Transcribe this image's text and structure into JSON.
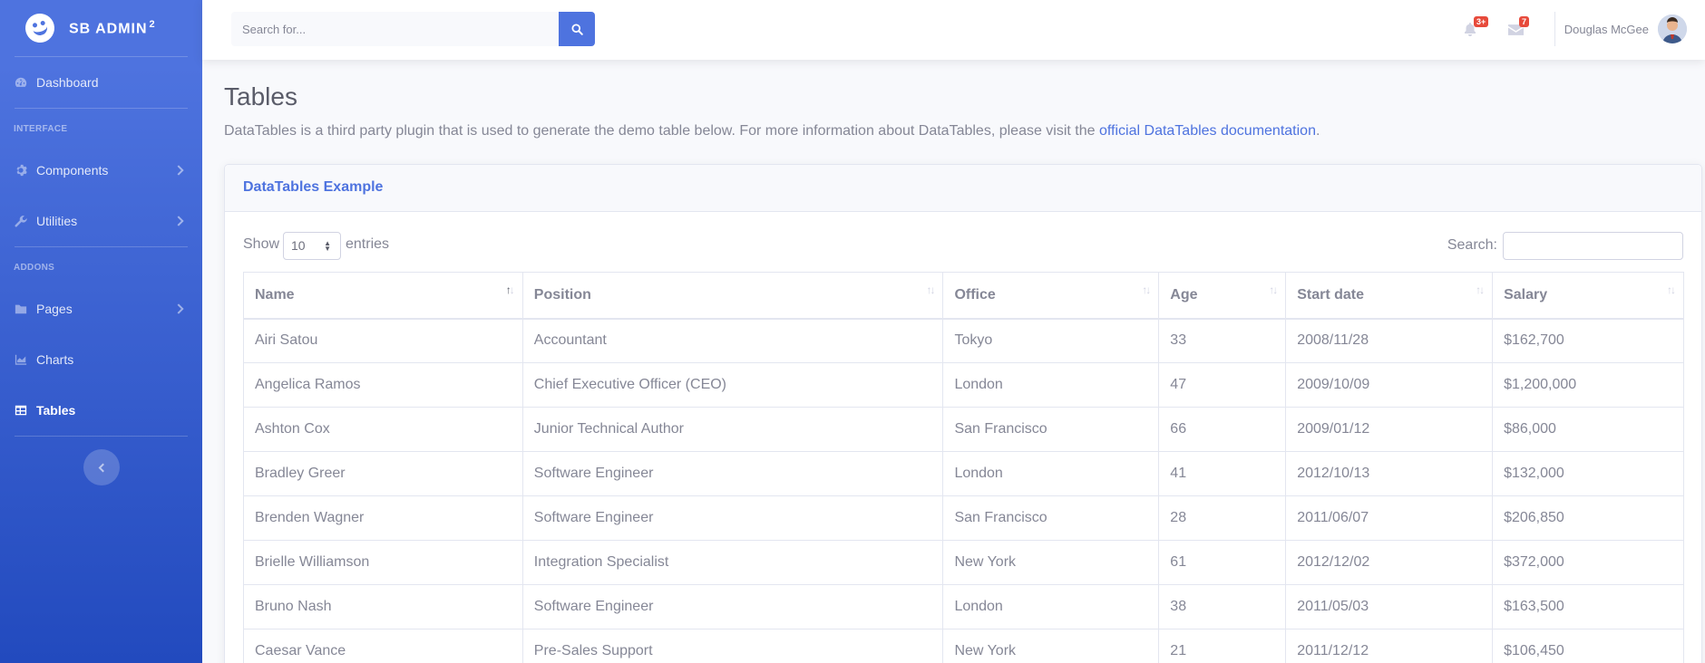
{
  "brand": {
    "name": "SB Admin",
    "sup": "2"
  },
  "sidebar": {
    "dashboard": "Dashboard",
    "heading_interface": "Interface",
    "components": "Components",
    "utilities": "Utilities",
    "heading_addons": "Addons",
    "pages": "Pages",
    "charts": "Charts",
    "tables": "Tables"
  },
  "topbar": {
    "search_placeholder": "Search for...",
    "alerts_badge": "3+",
    "messages_badge": "7",
    "user_name": "Douglas McGee"
  },
  "page": {
    "title": "Tables",
    "description": "DataTables is a third party plugin that is used to generate the demo table below. For more information about DataTables, please visit the ",
    "link_text": "official DataTables documentation",
    "description_end": "."
  },
  "card": {
    "title": "DataTables Example",
    "show_label": "Show",
    "length_value": "10",
    "entries_label": "entries",
    "search_label": "Search:"
  },
  "table": {
    "columns": [
      "Name",
      "Position",
      "Office",
      "Age",
      "Start date",
      "Salary"
    ],
    "rows": [
      [
        "Airi Satou",
        "Accountant",
        "Tokyo",
        "33",
        "2008/11/28",
        "$162,700"
      ],
      [
        "Angelica Ramos",
        "Chief Executive Officer (CEO)",
        "London",
        "47",
        "2009/10/09",
        "$1,200,000"
      ],
      [
        "Ashton Cox",
        "Junior Technical Author",
        "San Francisco",
        "66",
        "2009/01/12",
        "$86,000"
      ],
      [
        "Bradley Greer",
        "Software Engineer",
        "London",
        "41",
        "2012/10/13",
        "$132,000"
      ],
      [
        "Brenden Wagner",
        "Software Engineer",
        "San Francisco",
        "28",
        "2011/06/07",
        "$206,850"
      ],
      [
        "Brielle Williamson",
        "Integration Specialist",
        "New York",
        "61",
        "2012/12/02",
        "$372,000"
      ],
      [
        "Bruno Nash",
        "Software Engineer",
        "London",
        "38",
        "2011/05/03",
        "$163,500"
      ],
      [
        "Caesar Vance",
        "Pre-Sales Support",
        "New York",
        "21",
        "2011/12/12",
        "$106,450"
      ]
    ]
  },
  "colors": {
    "primary": "#4e73df",
    "danger": "#e74a3b",
    "text": "#858796"
  }
}
